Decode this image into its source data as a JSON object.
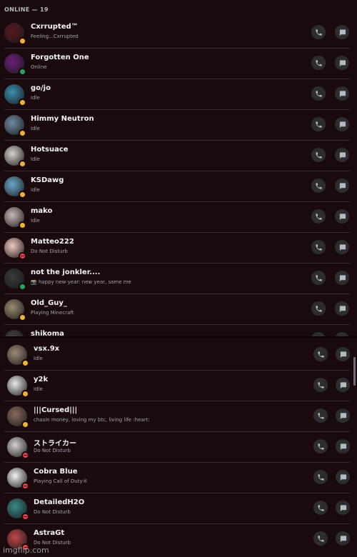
{
  "header": {
    "title": "ONLINE — 19"
  },
  "watermark": "imgflip.com",
  "colors": {
    "background": "#1a0a0d",
    "idle": "#f0b232",
    "online": "#23a55a",
    "dnd": "#f23f43",
    "button_bg": "#2b2d31"
  },
  "members": [
    {
      "name": "Cxrrupted™",
      "status_text": "Feeling...Cxrrupted",
      "status": "idle",
      "avatar_color": "#5a1820"
    },
    {
      "name": "Forgotten One",
      "status_text": "Online",
      "status": "online",
      "avatar_color": "#6b1f7a"
    },
    {
      "name": "go/jo",
      "status_text": "Idle",
      "status": "idle",
      "avatar_color": "#3c8fb0"
    },
    {
      "name": "Himmy Neutron",
      "status_text": "Idle",
      "status": "idle",
      "avatar_color": "#6f8aa6"
    },
    {
      "name": "Hotsuace",
      "status_text": "Idle",
      "status": "idle",
      "avatar_color": "#d7d2cc"
    },
    {
      "name": "KSDawg",
      "status_text": "Idle",
      "status": "idle",
      "avatar_color": "#6aa9cc"
    },
    {
      "name": "mako",
      "status_text": "Idle",
      "status": "idle",
      "avatar_color": "#c7b8b4"
    },
    {
      "name": "Matteo222",
      "status_text": "Do Not Disturb",
      "status": "dnd",
      "avatar_color": "#f0c8c0"
    },
    {
      "name": "not the jonkler....",
      "status_text": "📸 happy new year: new year, same me",
      "status": "online",
      "avatar_color": "#3a3a3a"
    },
    {
      "name": "Old_Guy_",
      "status_text": "Playing Minecraft",
      "status": "idle",
      "avatar_color": "#9a8a70"
    },
    {
      "name": "shikoma",
      "status_text": "",
      "status": "idle",
      "avatar_color": "#444448"
    },
    {
      "name": "vsx.9x",
      "status_text": "Idle",
      "status": "idle",
      "avatar_color": "#a08a78"
    },
    {
      "name": "y2k",
      "status_text": "Idle",
      "status": "idle",
      "avatar_color": "#e8e8e8"
    },
    {
      "name": "|||Cursed|||",
      "status_text": "chasin money, loving my btc, living life :heart:",
      "status": "idle",
      "avatar_color": "#8a6a5a"
    },
    {
      "name": "ストライカー",
      "status_text": "Do Not Disturb",
      "status": "dnd",
      "avatar_color": "#d8d0d0"
    },
    {
      "name": "Cobra Blue",
      "status_text": "Playing Call of Duty®",
      "status": "dnd",
      "avatar_color": "#f2f2f2"
    },
    {
      "name": "DetailedH2O",
      "status_text": "Do Not Disturb",
      "status": "dnd",
      "avatar_color": "#3a8a8a"
    },
    {
      "name": "AstraGt",
      "status_text": "Do Not Disturb",
      "status": "dnd",
      "avatar_color": "#c04848"
    }
  ],
  "actions": {
    "call_icon": "phone-icon",
    "message_icon": "message-icon"
  }
}
